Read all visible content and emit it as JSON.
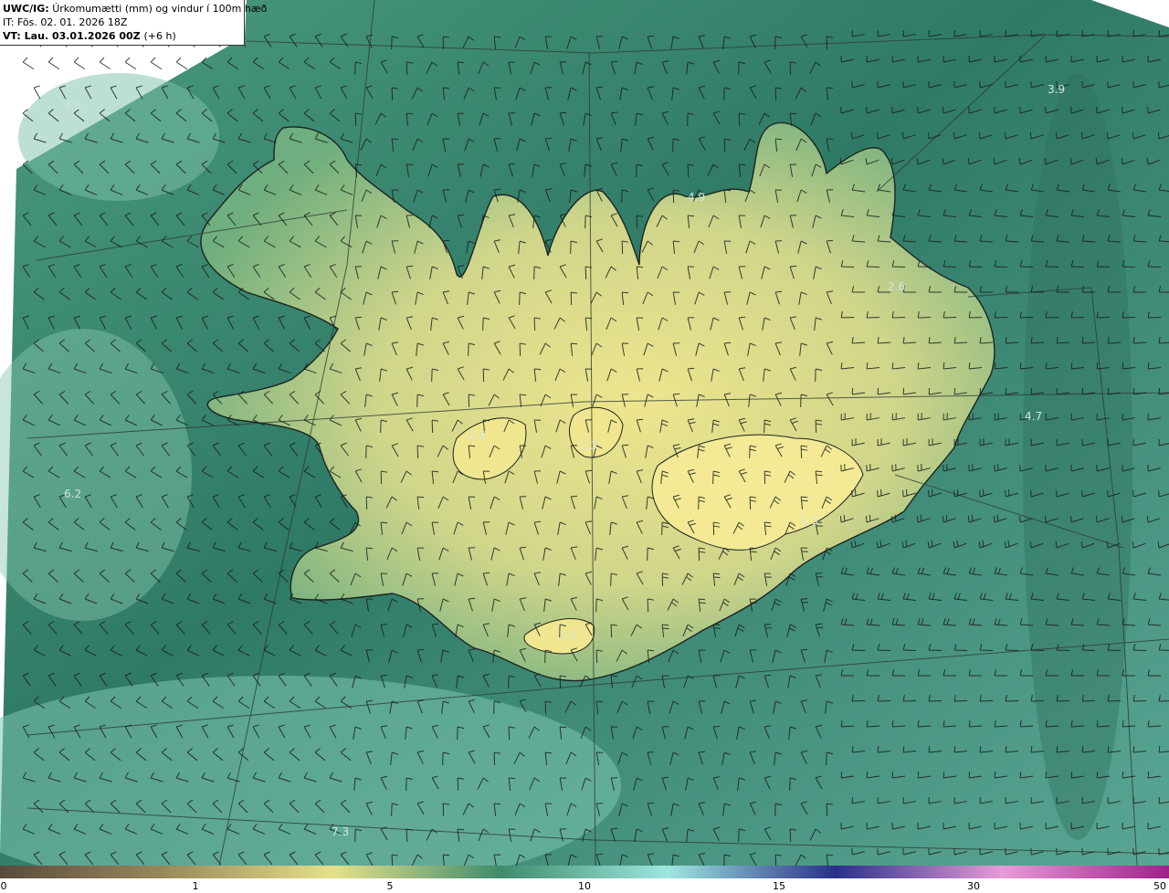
{
  "header": {
    "product": "UWC/IG:",
    "title": "Úrkomumætti (mm) og vindur í 100m hæð",
    "it_label": "IT:",
    "it_value": "Fös. 02. 01. 2026 18Z",
    "vt_label": "VT:",
    "vt_value": "Lau. 03.01.2026 00Z",
    "vt_offset": "(+6 h)"
  },
  "map_values": [
    "4.6",
    "3.9",
    "4.9",
    "2.6",
    "4.7",
    "6.2",
    "7.3",
    "2.6",
    "1.3",
    "1.5",
    "2.1"
  ],
  "colorbar": {
    "ticks": [
      "0",
      "1",
      "5",
      "10",
      "15",
      "30",
      "50"
    ],
    "colors": [
      "#5a4a3c",
      "#9c8a5c",
      "#e6e08a",
      "#3f8c6c",
      "#9fe6e0",
      "#2a2f8a",
      "#e89ad8",
      "#a0208a"
    ]
  },
  "colors": {
    "background_sea": "#3f8a72",
    "land_high": "#ecdf8a",
    "grid_line": "#2d3b35",
    "coastline": "#1c2420"
  }
}
